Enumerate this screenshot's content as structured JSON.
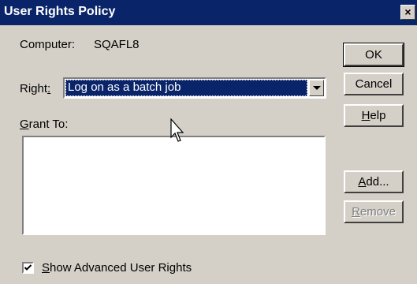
{
  "window": {
    "title": "User Rights Policy",
    "close_glyph": "×"
  },
  "computer": {
    "label": "Computer:",
    "value": "SQAFL8"
  },
  "right": {
    "label_prefix": "Right",
    "label_suffix": ":",
    "selected": "Log on as a batch job"
  },
  "grant_to": {
    "label_access_key": "G",
    "label_rest": "rant To:",
    "items": []
  },
  "buttons": {
    "ok": "OK",
    "cancel": "Cancel",
    "help_access_key": "H",
    "help_rest": "elp",
    "add_access_key": "A",
    "add_rest": "dd...",
    "remove_access_key": "R",
    "remove_rest": "emove"
  },
  "show_advanced": {
    "checked": true,
    "label_access_key": "S",
    "label_rest": "how Advanced User Rights"
  },
  "colors": {
    "titlebar": "#0a246a",
    "dialog_face": "#d4d0c8",
    "selection": "#0a246a"
  }
}
